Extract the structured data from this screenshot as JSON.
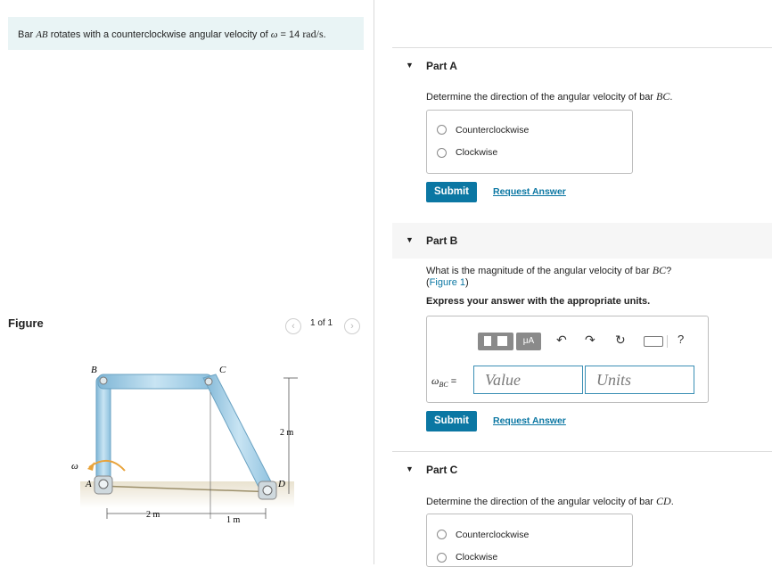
{
  "problem": {
    "prefix": "Bar ",
    "bar": "AB",
    "middle": " rotates with a counterclockwise angular velocity of ",
    "omega": "ω",
    "equals": " = 14 ",
    "unit": "rad/s",
    "suffix": "."
  },
  "figure": {
    "heading": "Figure",
    "pager": "1 of 1",
    "labels": {
      "B": "B",
      "C": "C",
      "A": "A",
      "D": "D",
      "omega": "ω",
      "dim_h": "2 m",
      "dim_left": "2 m",
      "dim_right": "1 m"
    }
  },
  "partA": {
    "title": "Part A",
    "question_prefix": "Determine the direction of the angular velocity of bar ",
    "bar": "BC",
    "question_suffix": ".",
    "options": [
      "Counterclockwise",
      "Clockwise"
    ],
    "submit": "Submit",
    "request": "Request Answer"
  },
  "partB": {
    "title": "Part B",
    "question_prefix": "What is the magnitude of the angular velocity of bar ",
    "bar": "BC",
    "question_suffix": "?",
    "figure_link": "Figure 1",
    "instruction": "Express your answer with the appropriate units.",
    "var_label": "ω",
    "var_sub": "BC",
    "eq": "=",
    "value_placeholder": "Value",
    "units_placeholder": "Units",
    "toolbar": {
      "mu": "μA",
      "help": "?"
    },
    "submit": "Submit",
    "request": "Request Answer"
  },
  "partC": {
    "title": "Part C",
    "question_prefix": "Determine the direction of the angular velocity of bar ",
    "bar": "CD",
    "question_suffix": ".",
    "options": [
      "Counterclockwise",
      "Clockwise"
    ]
  }
}
